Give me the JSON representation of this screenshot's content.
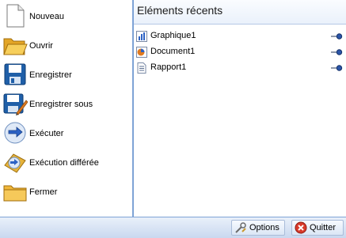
{
  "menu": {
    "items": [
      {
        "label": "Nouveau",
        "icon": "new-document-icon"
      },
      {
        "label": "Ouvrir",
        "icon": "open-folder-icon"
      },
      {
        "label": "Enregistrer",
        "icon": "save-disk-icon"
      },
      {
        "label": "Enregistrer sous",
        "icon": "save-as-icon"
      },
      {
        "label": "Exécuter",
        "icon": "run-arrow-icon"
      },
      {
        "label": "Exécution différée",
        "icon": "scheduled-run-icon"
      },
      {
        "label": "Fermer",
        "icon": "close-folder-icon"
      }
    ]
  },
  "recent": {
    "title": "Eléments récents",
    "items": [
      {
        "label": "Graphique1",
        "icon": "chart-document-icon"
      },
      {
        "label": "Document1",
        "icon": "document-icon"
      },
      {
        "label": "Rapport1",
        "icon": "report-icon"
      }
    ]
  },
  "footer": {
    "options_label": "Options",
    "quit_label": "Quitter"
  },
  "colors": {
    "accent": "#7ea3d6",
    "footer_bg": "#c9d8ef"
  }
}
